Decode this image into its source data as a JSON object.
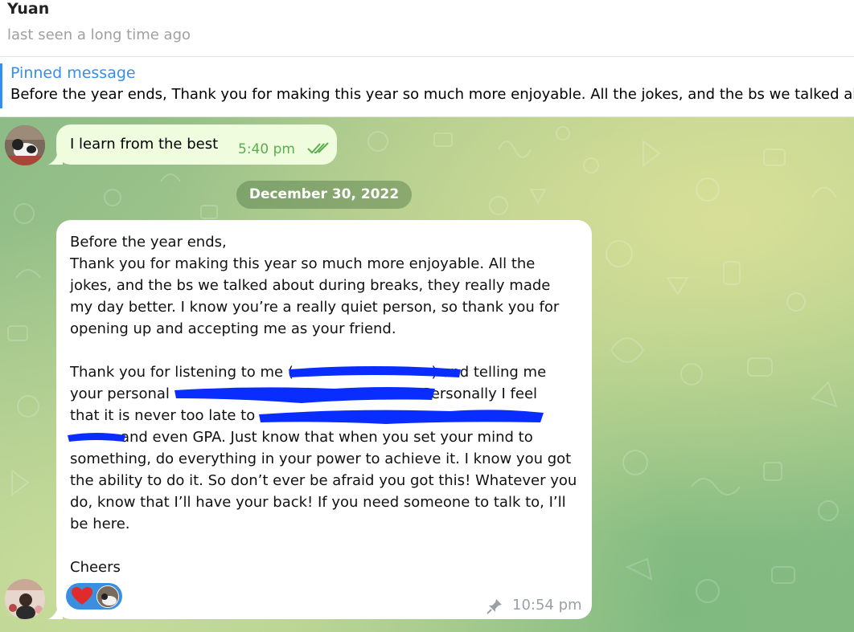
{
  "header": {
    "contact_name": "Yuan",
    "status": "last seen a long time ago"
  },
  "pinned": {
    "title": "Pinned message",
    "text": "Before the year ends,  Thank you for making this year so much more enjoyable. All the jokes, and the bs we talked about during breaks"
  },
  "messages": [
    {
      "text": "I learn from the best",
      "time": "5:40 pm",
      "status": "read"
    }
  ],
  "date_separator": "December 30, 2022",
  "letter": {
    "lines": [
      "Before the year ends,",
      "Thank you for making this year so much more enjoyable. All the",
      "jokes, and the bs we talked about during breaks, they really made",
      "my day better. I know you’re a really quiet person, so thank you for",
      "opening up and accepting me as your friend.",
      "",
      "Thank you for listening to me (                              ) and telling me",
      "your personal                                                       Personally I feel",
      "that it is never too late to                                                          ,",
      "           and even GPA. Just know that when you set your mind to",
      "something, do everything in your power to achieve it. I know you got",
      "the ability to do it. So don’t ever be afraid you got this! Whatever you",
      "do, know that I’ll have your back! If you need someone to talk to, I’ll",
      "be here.",
      "",
      "Cheers"
    ],
    "time": "10:54 pm",
    "pinned": true,
    "reactions": [
      "heart"
    ]
  },
  "colors": {
    "accent": "#3390ec",
    "outgoing_bubble": "#effdde",
    "read_check": "#5aae4e",
    "redaction": "#0a2dff",
    "reaction_pill": "#3a8fe0"
  }
}
